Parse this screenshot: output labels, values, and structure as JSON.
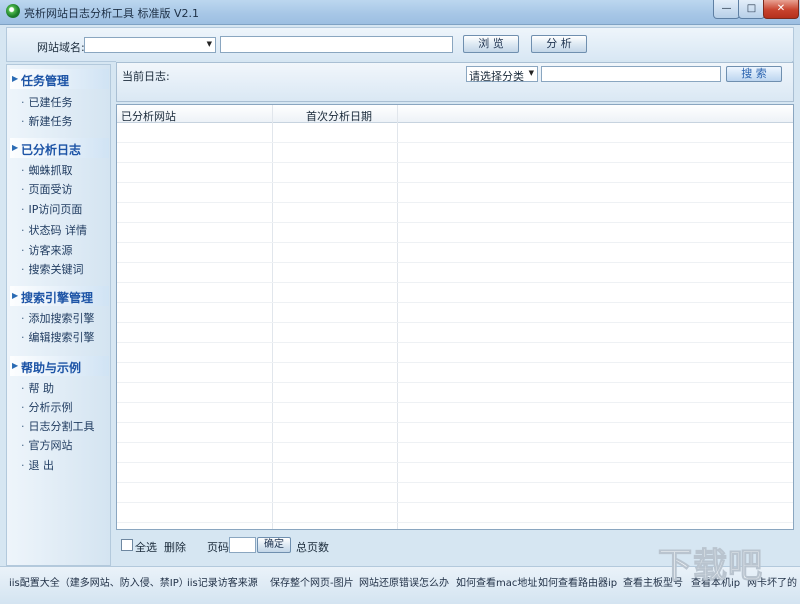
{
  "window": {
    "title": "亮析网站日志分析工具 标准版 V2.1",
    "min_label": "—",
    "max_label": "□",
    "close_label": "✕"
  },
  "topbar": {
    "domain_label": "网站域名:",
    "domain_select_value": "",
    "path_value": "",
    "browse_label": "浏 览",
    "analyze_label": "分 析"
  },
  "sidebar": {
    "sections": [
      {
        "title": "任务管理",
        "items": [
          "已建任务",
          "新建任务"
        ]
      },
      {
        "title": "已分析日志",
        "items": [
          "蜘蛛抓取",
          "页面受访",
          "IP访问页面",
          "状态码  详情",
          "访客来源",
          "搜索关键词"
        ]
      },
      {
        "title": "搜索引擎管理",
        "items": [
          "添加搜索引擎",
          "编辑搜索引擎"
        ]
      },
      {
        "title": "帮助与示例",
        "items": [
          "帮  助",
          "分析示例",
          "日志分割工具",
          "官方网站",
          "退  出"
        ]
      }
    ]
  },
  "main": {
    "current_log_label": "当前日志:",
    "category_select": "请选择分类",
    "search_value": "",
    "search_label": "搜  索",
    "table": {
      "columns": [
        "已分析网站",
        "首次分析日期"
      ],
      "rows": []
    },
    "footer": {
      "select_all": "全选",
      "delete": "删除",
      "page_label": "页码",
      "page_value": "",
      "confirm": "确定",
      "total_pages": "总页数"
    }
  },
  "status_links": [
    "iis配置大全（建多网站、防入侵、禁IP）",
    "iis记录访客来源",
    "保存整个网页-图片",
    "网站还原错误怎么办",
    "如何查看mac地址",
    "如何查看路由器ip",
    "查看主板型号",
    "查看本机ip",
    "网卡坏了的"
  ],
  "watermark": "下载吧"
}
